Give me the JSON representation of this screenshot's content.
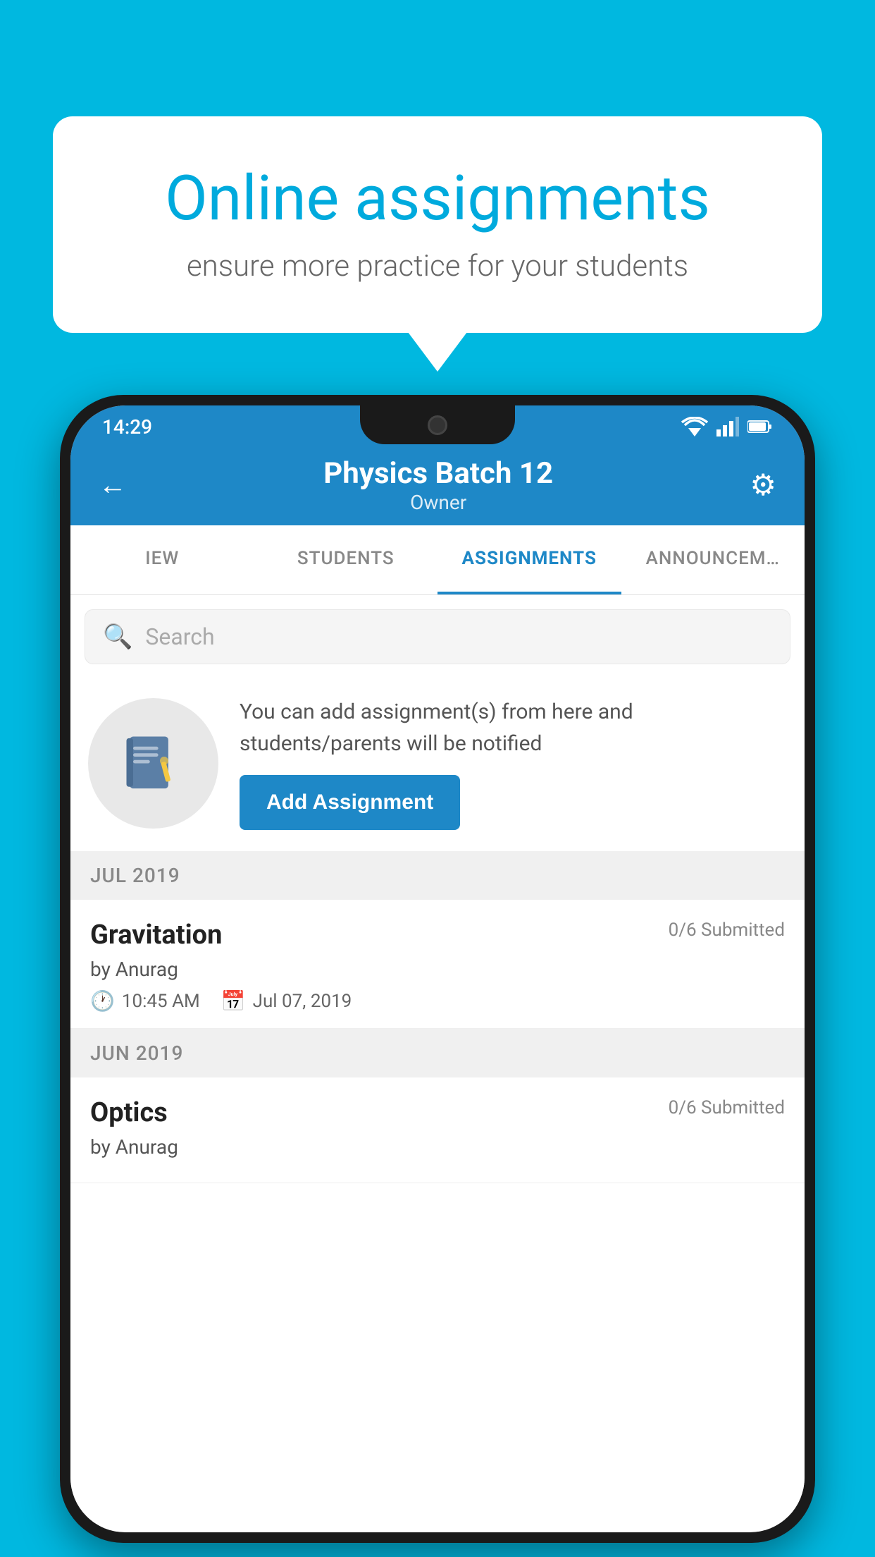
{
  "background": {
    "color": "#00b8e0"
  },
  "speech_bubble": {
    "title": "Online assignments",
    "subtitle": "ensure more practice for your students"
  },
  "status_bar": {
    "time": "14:29",
    "wifi_icon": "▼",
    "signal_icon": "▲",
    "battery_icon": "▮"
  },
  "top_bar": {
    "title": "Physics Batch 12",
    "subtitle": "Owner",
    "back_icon": "←",
    "settings_icon": "⚙"
  },
  "tabs": [
    {
      "label": "IEW",
      "active": false
    },
    {
      "label": "STUDENTS",
      "active": false
    },
    {
      "label": "ASSIGNMENTS",
      "active": true
    },
    {
      "label": "ANNOUNCEM…",
      "active": false
    }
  ],
  "search": {
    "placeholder": "Search"
  },
  "promo": {
    "description": "You can add assignment(s) from here and students/parents will be notified",
    "button_label": "Add Assignment"
  },
  "sections": [
    {
      "label": "JUL 2019",
      "assignments": [
        {
          "title": "Gravitation",
          "submitted": "0/6 Submitted",
          "by": "by Anurag",
          "time": "10:45 AM",
          "date": "Jul 07, 2019"
        }
      ]
    },
    {
      "label": "JUN 2019",
      "assignments": [
        {
          "title": "Optics",
          "submitted": "0/6 Submitted",
          "by": "by Anurag",
          "time": "",
          "date": ""
        }
      ]
    }
  ]
}
